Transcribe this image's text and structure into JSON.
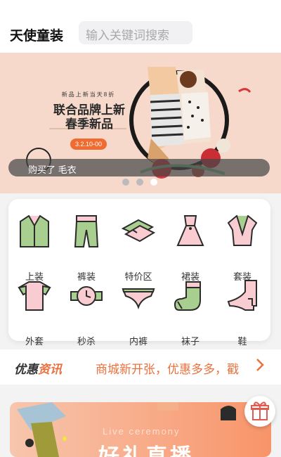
{
  "header": {
    "brand": "天使童装",
    "search_placeholder": "输入关键词搜索"
  },
  "banner": {
    "promo_line": "新品上新当天8折",
    "promo_title_1": "联合品牌上新",
    "promo_title_2": "春季新品",
    "promo_date": "3.2.10-00",
    "purchase_notice": "购买了 毛衣",
    "active_dot": 2
  },
  "categories": [
    {
      "label": "上装",
      "icon": "shirt-icon"
    },
    {
      "label": "裤装",
      "icon": "pants-icon"
    },
    {
      "label": "特价区",
      "icon": "folded-clothes-icon"
    },
    {
      "label": "裙装",
      "icon": "dress-icon"
    },
    {
      "label": "套装",
      "icon": "coat-icon"
    },
    {
      "label": "外套",
      "icon": "tshirt-icon"
    },
    {
      "label": "秒杀",
      "icon": "watch-icon"
    },
    {
      "label": "内裤",
      "icon": "underwear-icon"
    },
    {
      "label": "袜子",
      "icon": "sock-icon"
    },
    {
      "label": "鞋",
      "icon": "high-heel-icon"
    }
  ],
  "news": {
    "logo_part1": "优惠",
    "logo_part2": "资讯",
    "text": "商城新开张，优惠多多，戳"
  },
  "promo": {
    "english": "Live ceremony",
    "title": "好礼直播"
  },
  "colors": {
    "accent": "#e9713f",
    "icon_green": "#a8cf8f",
    "icon_pink": "#f8ccd0"
  }
}
